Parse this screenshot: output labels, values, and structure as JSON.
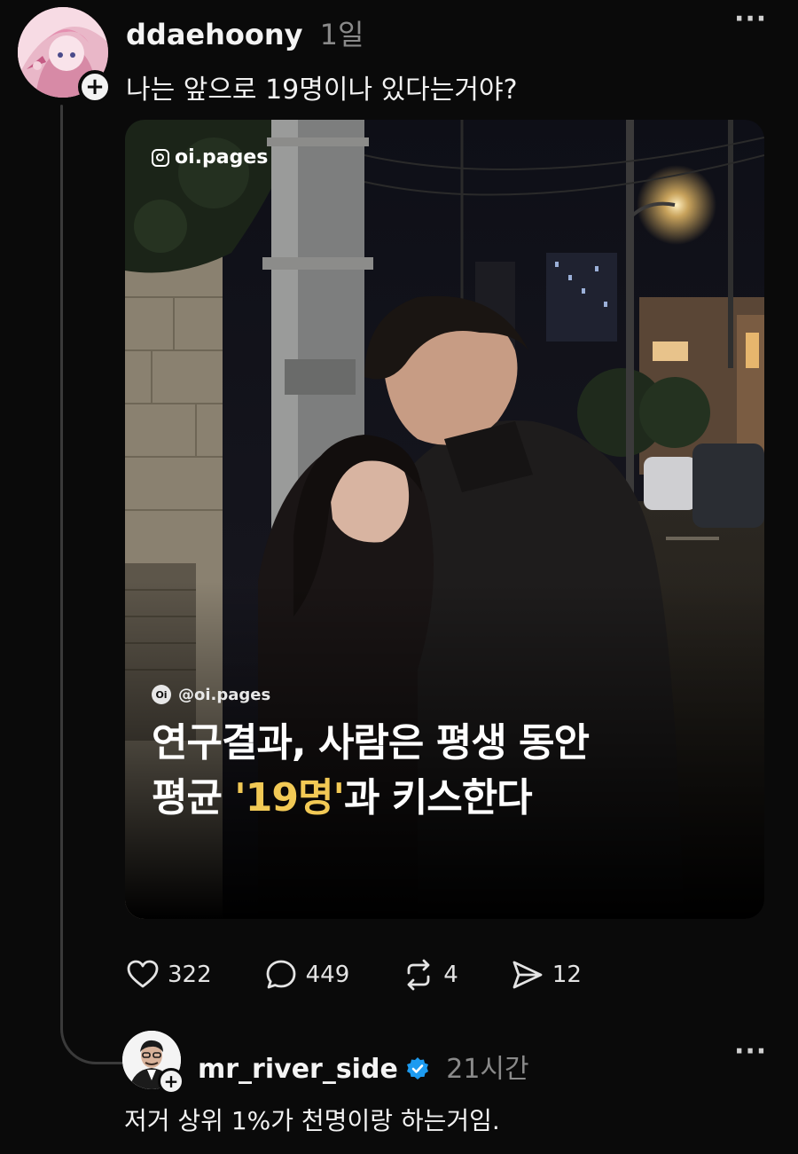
{
  "post": {
    "username": "ddaehoony",
    "time": "1일",
    "text": "나는 앞으로 19명이나 있다는거야?",
    "more_icon": "more-horizontal-icon",
    "media": {
      "watermark": "oi.pages",
      "brand_handle": "@oi.pages",
      "brand_logo_text": "Oi",
      "headline_line1": "연구결과, 사람은 평생 동안",
      "headline_line2_prefix": "평균 ",
      "headline_highlight": "'19명'",
      "headline_line2_suffix": "과 키스한다",
      "highlight_color": "#f2c955"
    },
    "actions": {
      "likes": "322",
      "comments": "449",
      "reposts": "4",
      "shares": "12"
    }
  },
  "reply": {
    "username": "mr_river_side",
    "verified": true,
    "time": "21시간",
    "text": "저거 상위 1%가 천명이랑 하는거임."
  }
}
